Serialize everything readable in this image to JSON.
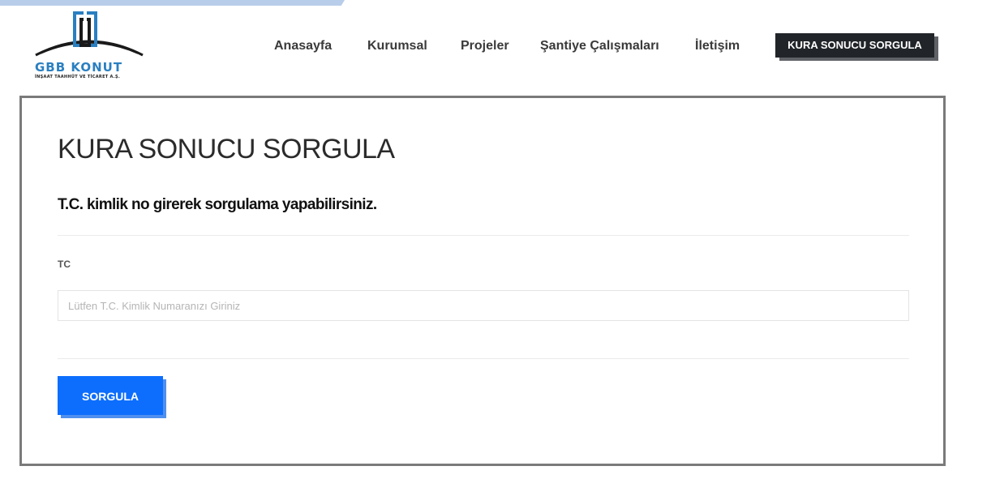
{
  "logo": {
    "name": "GBB KONUT",
    "subtitle": "İNŞAAT TAAHHÜT VE TİCARET A.Ş."
  },
  "nav": {
    "items": [
      {
        "label": "Anasayfa"
      },
      {
        "label": "Kurumsal"
      },
      {
        "label": "Projeler"
      },
      {
        "label": "Şantiye Çalışmaları"
      },
      {
        "label": "İletişim"
      }
    ],
    "cta_label": "KURA SONUCU SORGULA"
  },
  "main": {
    "title": "KURA SONUCU SORGULA",
    "subtitle": "T.C. kimlik no girerek sorgulama yapabilirsiniz.",
    "tc_label": "TC",
    "tc_value": "",
    "tc_placeholder": "Lütfen T.C. Kimlik Numaranızı Giriniz",
    "submit_label": "SORGULA"
  },
  "colors": {
    "accent_blue": "#0d6efd",
    "cta_dark": "#212529",
    "logo_blue": "#2a7fc0",
    "top_accent": "#b8cdea"
  }
}
